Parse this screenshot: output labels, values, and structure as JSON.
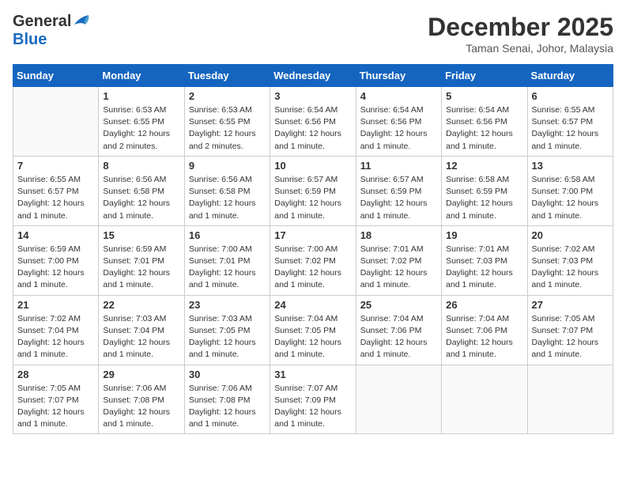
{
  "header": {
    "logo_general": "General",
    "logo_blue": "Blue",
    "month_title": "December 2025",
    "location": "Taman Senai, Johor, Malaysia"
  },
  "days_of_week": [
    "Sunday",
    "Monday",
    "Tuesday",
    "Wednesday",
    "Thursday",
    "Friday",
    "Saturday"
  ],
  "weeks": [
    [
      {
        "num": "",
        "detail": ""
      },
      {
        "num": "1",
        "detail": "Sunrise: 6:53 AM\nSunset: 6:55 PM\nDaylight: 12 hours\nand 2 minutes."
      },
      {
        "num": "2",
        "detail": "Sunrise: 6:53 AM\nSunset: 6:55 PM\nDaylight: 12 hours\nand 2 minutes."
      },
      {
        "num": "3",
        "detail": "Sunrise: 6:54 AM\nSunset: 6:56 PM\nDaylight: 12 hours\nand 1 minute."
      },
      {
        "num": "4",
        "detail": "Sunrise: 6:54 AM\nSunset: 6:56 PM\nDaylight: 12 hours\nand 1 minute."
      },
      {
        "num": "5",
        "detail": "Sunrise: 6:54 AM\nSunset: 6:56 PM\nDaylight: 12 hours\nand 1 minute."
      },
      {
        "num": "6",
        "detail": "Sunrise: 6:55 AM\nSunset: 6:57 PM\nDaylight: 12 hours\nand 1 minute."
      }
    ],
    [
      {
        "num": "7",
        "detail": "Sunrise: 6:55 AM\nSunset: 6:57 PM\nDaylight: 12 hours\nand 1 minute."
      },
      {
        "num": "8",
        "detail": "Sunrise: 6:56 AM\nSunset: 6:58 PM\nDaylight: 12 hours\nand 1 minute."
      },
      {
        "num": "9",
        "detail": "Sunrise: 6:56 AM\nSunset: 6:58 PM\nDaylight: 12 hours\nand 1 minute."
      },
      {
        "num": "10",
        "detail": "Sunrise: 6:57 AM\nSunset: 6:59 PM\nDaylight: 12 hours\nand 1 minute."
      },
      {
        "num": "11",
        "detail": "Sunrise: 6:57 AM\nSunset: 6:59 PM\nDaylight: 12 hours\nand 1 minute."
      },
      {
        "num": "12",
        "detail": "Sunrise: 6:58 AM\nSunset: 6:59 PM\nDaylight: 12 hours\nand 1 minute."
      },
      {
        "num": "13",
        "detail": "Sunrise: 6:58 AM\nSunset: 7:00 PM\nDaylight: 12 hours\nand 1 minute."
      }
    ],
    [
      {
        "num": "14",
        "detail": "Sunrise: 6:59 AM\nSunset: 7:00 PM\nDaylight: 12 hours\nand 1 minute."
      },
      {
        "num": "15",
        "detail": "Sunrise: 6:59 AM\nSunset: 7:01 PM\nDaylight: 12 hours\nand 1 minute."
      },
      {
        "num": "16",
        "detail": "Sunrise: 7:00 AM\nSunset: 7:01 PM\nDaylight: 12 hours\nand 1 minute."
      },
      {
        "num": "17",
        "detail": "Sunrise: 7:00 AM\nSunset: 7:02 PM\nDaylight: 12 hours\nand 1 minute."
      },
      {
        "num": "18",
        "detail": "Sunrise: 7:01 AM\nSunset: 7:02 PM\nDaylight: 12 hours\nand 1 minute."
      },
      {
        "num": "19",
        "detail": "Sunrise: 7:01 AM\nSunset: 7:03 PM\nDaylight: 12 hours\nand 1 minute."
      },
      {
        "num": "20",
        "detail": "Sunrise: 7:02 AM\nSunset: 7:03 PM\nDaylight: 12 hours\nand 1 minute."
      }
    ],
    [
      {
        "num": "21",
        "detail": "Sunrise: 7:02 AM\nSunset: 7:04 PM\nDaylight: 12 hours\nand 1 minute."
      },
      {
        "num": "22",
        "detail": "Sunrise: 7:03 AM\nSunset: 7:04 PM\nDaylight: 12 hours\nand 1 minute."
      },
      {
        "num": "23",
        "detail": "Sunrise: 7:03 AM\nSunset: 7:05 PM\nDaylight: 12 hours\nand 1 minute."
      },
      {
        "num": "24",
        "detail": "Sunrise: 7:04 AM\nSunset: 7:05 PM\nDaylight: 12 hours\nand 1 minute."
      },
      {
        "num": "25",
        "detail": "Sunrise: 7:04 AM\nSunset: 7:06 PM\nDaylight: 12 hours\nand 1 minute."
      },
      {
        "num": "26",
        "detail": "Sunrise: 7:04 AM\nSunset: 7:06 PM\nDaylight: 12 hours\nand 1 minute."
      },
      {
        "num": "27",
        "detail": "Sunrise: 7:05 AM\nSunset: 7:07 PM\nDaylight: 12 hours\nand 1 minute."
      }
    ],
    [
      {
        "num": "28",
        "detail": "Sunrise: 7:05 AM\nSunset: 7:07 PM\nDaylight: 12 hours\nand 1 minute."
      },
      {
        "num": "29",
        "detail": "Sunrise: 7:06 AM\nSunset: 7:08 PM\nDaylight: 12 hours\nand 1 minute."
      },
      {
        "num": "30",
        "detail": "Sunrise: 7:06 AM\nSunset: 7:08 PM\nDaylight: 12 hours\nand 1 minute."
      },
      {
        "num": "31",
        "detail": "Sunrise: 7:07 AM\nSunset: 7:09 PM\nDaylight: 12 hours\nand 1 minute."
      },
      {
        "num": "",
        "detail": ""
      },
      {
        "num": "",
        "detail": ""
      },
      {
        "num": "",
        "detail": ""
      }
    ]
  ]
}
